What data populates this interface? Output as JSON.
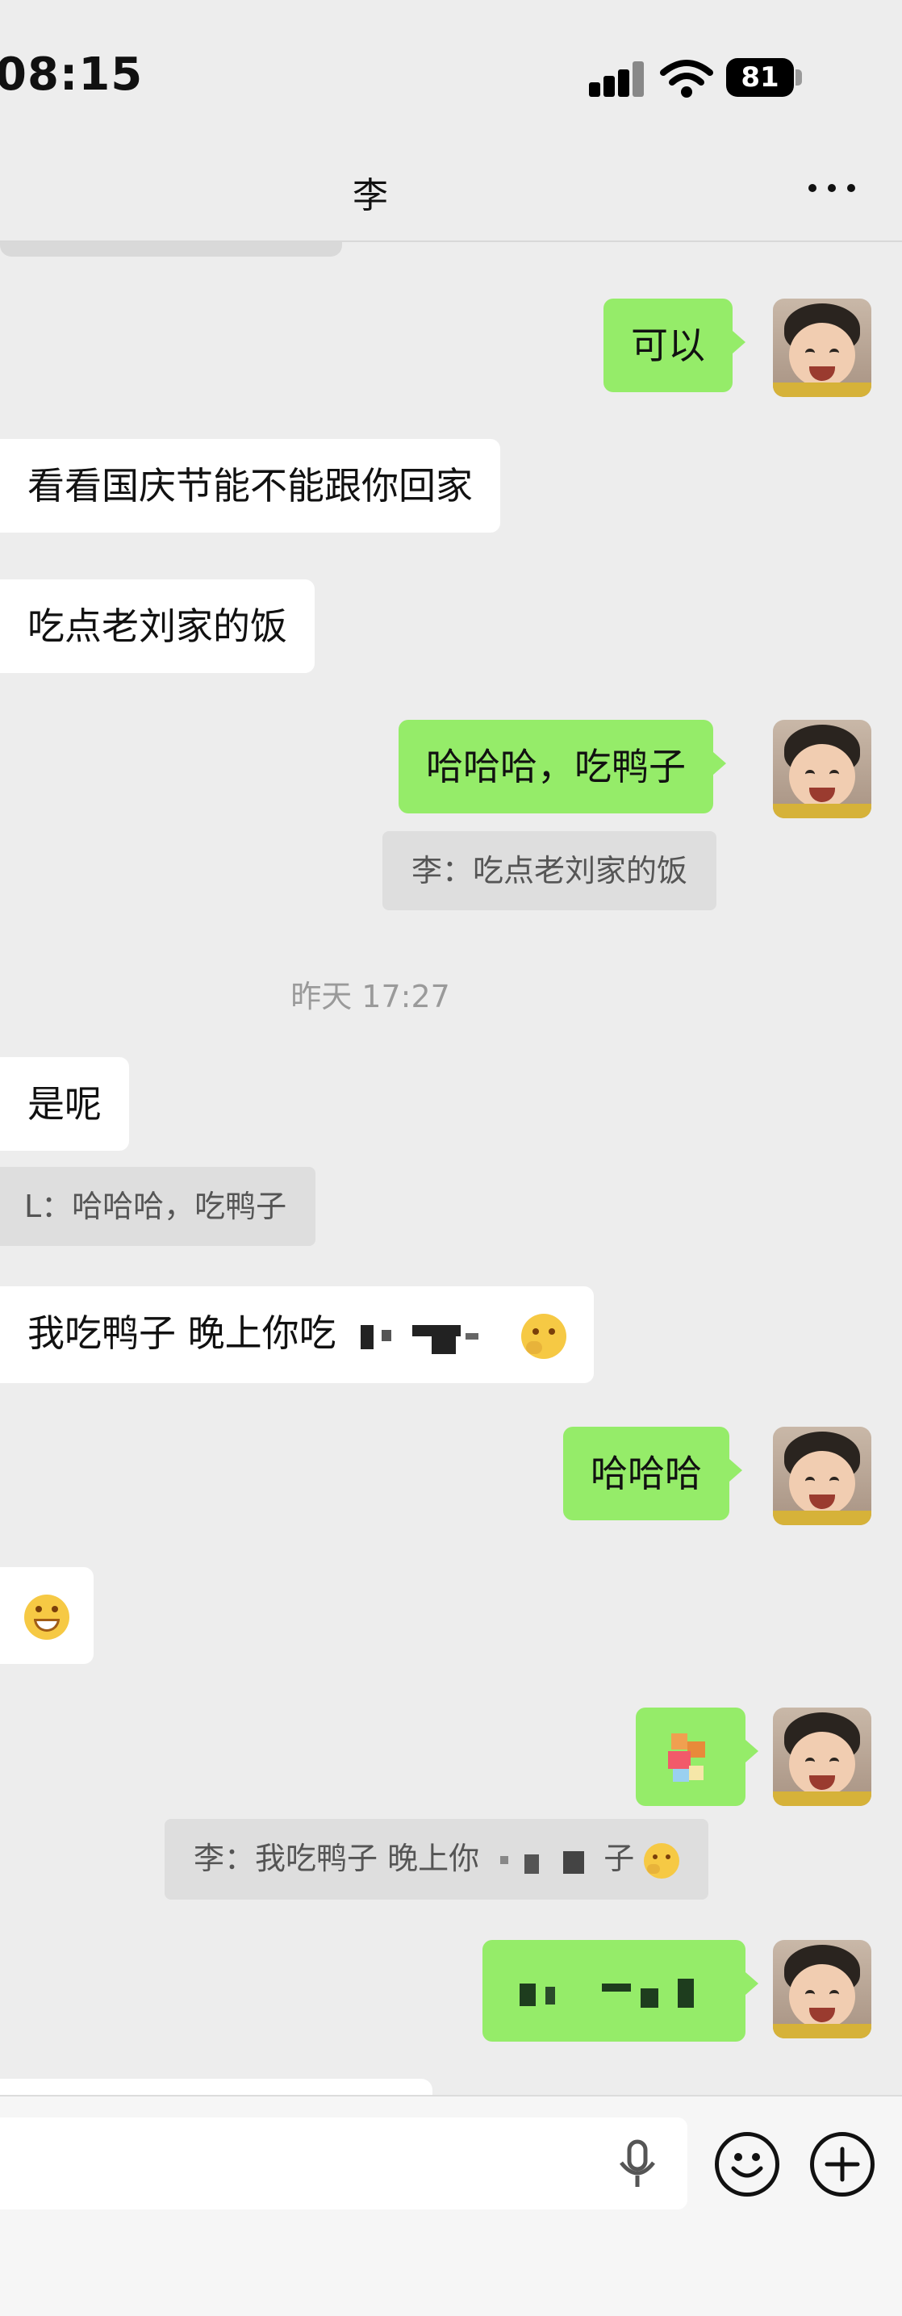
{
  "status_bar": {
    "time": "08:15",
    "battery": "81"
  },
  "header": {
    "title": "李"
  },
  "messages": {
    "m1": "可以",
    "m2": "看看国庆节能不能跟你回家",
    "m3": "吃点老刘家的饭",
    "m4": "哈哈哈，吃鸭子",
    "m4_quote": "李：吃点老刘家的饭",
    "timestamp": "昨天 17:27",
    "m5": "是呢",
    "m5_quote": "L：哈哈哈，吃鸭子",
    "m6": "我吃鸭子 晚上你吃",
    "m7": "哈哈哈",
    "m9_quote_a": "李：我吃鸭子 晚上你",
    "m9_quote_b": "子"
  },
  "icons": {
    "signal": "cellular-signal-icon",
    "wifi": "wifi-icon",
    "battery": "battery-icon",
    "more": "more-dots-icon",
    "mic": "microphone-icon",
    "emoji": "emoji-smile-icon",
    "plus": "add-circle-icon"
  },
  "colors": {
    "outgoing_bubble": "#95ec69",
    "incoming_bubble": "#ffffff",
    "background": "#ededed"
  }
}
